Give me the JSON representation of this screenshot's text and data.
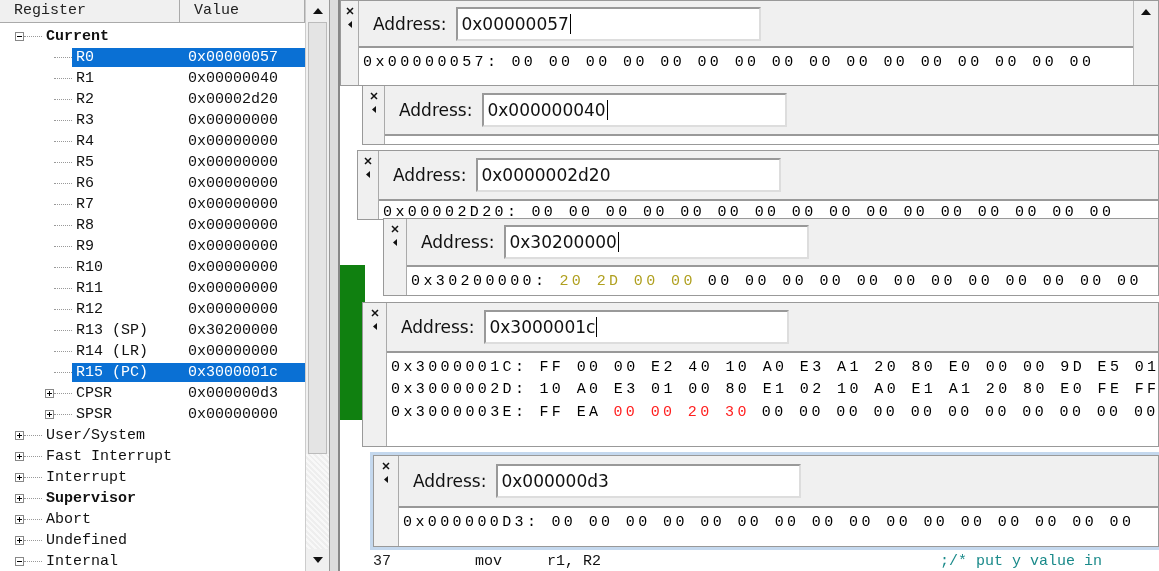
{
  "registers": {
    "columns": [
      "Register",
      "Value"
    ],
    "tree": [
      {
        "name": "Current",
        "bold": true,
        "expanded": true,
        "children": [
          {
            "name": "R0",
            "value": "0x00000057",
            "selected": true
          },
          {
            "name": "R1",
            "value": "0x00000040",
            "selected": false
          },
          {
            "name": "R2",
            "value": "0x00002d20",
            "selected": false
          },
          {
            "name": "R3",
            "value": "0x00000000",
            "selected": false
          },
          {
            "name": "R4",
            "value": "0x00000000",
            "selected": false
          },
          {
            "name": "R5",
            "value": "0x00000000",
            "selected": false
          },
          {
            "name": "R6",
            "value": "0x00000000",
            "selected": false
          },
          {
            "name": "R7",
            "value": "0x00000000",
            "selected": false
          },
          {
            "name": "R8",
            "value": "0x00000000",
            "selected": false
          },
          {
            "name": "R9",
            "value": "0x00000000",
            "selected": false
          },
          {
            "name": "R10",
            "value": "0x00000000",
            "selected": false
          },
          {
            "name": "R11",
            "value": "0x00000000",
            "selected": false
          },
          {
            "name": "R12",
            "value": "0x00000000",
            "selected": false
          },
          {
            "name": "R13 (SP)",
            "value": "0x30200000",
            "selected": false
          },
          {
            "name": "R14 (LR)",
            "value": "0x00000000",
            "selected": false
          },
          {
            "name": "R15 (PC)",
            "value": "0x3000001c",
            "selected": true
          },
          {
            "name": "CPSR",
            "value": "0x000000d3",
            "selected": false,
            "expanded": false
          },
          {
            "name": "SPSR",
            "value": "0x00000000",
            "selected": false,
            "expanded": false
          }
        ]
      },
      {
        "name": "User/System",
        "bold": false,
        "expanded": false
      },
      {
        "name": "Fast Interrupt",
        "bold": false,
        "expanded": false
      },
      {
        "name": "Interrupt",
        "bold": false,
        "expanded": false
      },
      {
        "name": "Supervisor",
        "bold": true,
        "expanded": false
      },
      {
        "name": "Abort",
        "bold": false,
        "expanded": false
      },
      {
        "name": "Undefined",
        "bold": false,
        "expanded": false
      },
      {
        "name": "Internal",
        "bold": false,
        "expanded": true
      }
    ]
  },
  "memory_windows": [
    {
      "label": "Address:",
      "address": "0x00000057",
      "caret": true,
      "rows": [
        {
          "address": "0x00000057:",
          "segments": [
            {
              "text": "00 00 00 00 00 00 00 00 00 00 00 00 00 00 00 00",
              "color": "#000000"
            }
          ]
        }
      ]
    },
    {
      "label": "Address:",
      "address": "0x000000040",
      "caret": true
    },
    {
      "label": "Address:",
      "address": "0x0000002d20",
      "caret": false,
      "rows": [
        {
          "address": "0x00002D20:",
          "segments": [
            {
              "text": "00 00 00 00 00 00 00 00 00 00 00 00 00 00 00 00",
              "color": "#000000"
            }
          ]
        }
      ]
    },
    {
      "label": "Address:",
      "address": "0x30200000",
      "caret": true,
      "rows": [
        {
          "address": "0x30200000:",
          "segments": [
            {
              "text": "20 2D 00 00",
              "color": "#b0a020"
            },
            {
              "text": "00 00 00 00 00 00 00 00 00 00 00 00",
              "color": "#000000"
            }
          ]
        }
      ]
    },
    {
      "label": "Address:",
      "address": "0x3000001c",
      "caret": true,
      "rows": [
        {
          "address": "0x3000001C:",
          "segments": [
            {
              "text": "FF 00 00 E2 40 10 A0 E3 A1 20 80 E0 00 00 9D E5 01",
              "color": "#000000"
            }
          ]
        },
        {
          "address": "0x3000002D:",
          "segments": [
            {
              "text": "10 A0 E3 01 00 80 E1 02 10 A0 E1 A1 20 80 E0 FE FF",
              "color": "#000000"
            }
          ]
        },
        {
          "address": "0x3000003E:",
          "segments": [
            {
              "text": "FF EA",
              "color": "#000000"
            },
            {
              "text": "00 00 20 30",
              "color": "#ff2020"
            },
            {
              "text": "00 00 00 00 00 00 00 00 00 00 00",
              "color": "#000000"
            }
          ]
        }
      ]
    },
    {
      "label": "Address:",
      "address": "0x000000d3",
      "caret": false,
      "rows": [
        {
          "address": "0x000000D3:",
          "segments": [
            {
              "text": "00 00 00 00 00 00 00 00 00 00 00 00 00 00 00 00",
              "color": "#000000"
            }
          ]
        }
      ]
    }
  ],
  "editor": {
    "line_number": "37",
    "code": "mov     r1, R2",
    "comment": ";/* put y value in"
  }
}
